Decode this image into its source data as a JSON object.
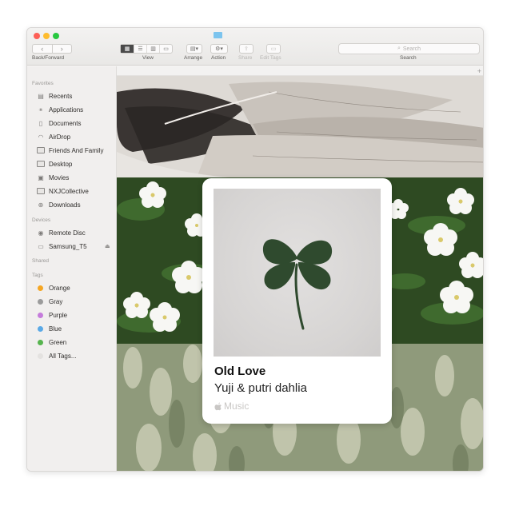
{
  "toolbar": {
    "nav_back_icon": "chevron-left",
    "nav_forward_icon": "chevron-right",
    "back_forward_label": "Back/Forward",
    "view_label": "View",
    "arrange_label": "Arrange",
    "action_label": "Action",
    "share_label": "Share",
    "edit_tags_label": "Edit Tags",
    "search_placeholder": "Search",
    "search_label": "Search"
  },
  "sidebar": {
    "favorites_header": "Favorites",
    "favorites": [
      {
        "label": "Recents",
        "icon": "recents-icon"
      },
      {
        "label": "Applications",
        "icon": "applications-icon"
      },
      {
        "label": "Documents",
        "icon": "documents-icon"
      },
      {
        "label": "AirDrop",
        "icon": "airdrop-icon"
      },
      {
        "label": "Friends And Family",
        "icon": "folder-icon"
      },
      {
        "label": "Desktop",
        "icon": "desktop-icon"
      },
      {
        "label": "Movies",
        "icon": "movies-icon"
      },
      {
        "label": "NXJCollective",
        "icon": "folder-icon"
      },
      {
        "label": "Downloads",
        "icon": "downloads-icon"
      }
    ],
    "devices_header": "Devices",
    "devices": [
      {
        "label": "Remote Disc",
        "icon": "disc-icon"
      },
      {
        "label": "Samsung_T5",
        "icon": "drive-icon"
      }
    ],
    "shared_header": "Shared",
    "tags_header": "Tags",
    "tags": [
      {
        "label": "Orange",
        "color": "#f5a623"
      },
      {
        "label": "Gray",
        "color": "#9b9b9b"
      },
      {
        "label": "Purple",
        "color": "#c57cdb"
      },
      {
        "label": "Blue",
        "color": "#5aa9e6"
      },
      {
        "label": "Green",
        "color": "#56b44e"
      },
      {
        "label": "All Tags...",
        "color": "#e4e2e0"
      }
    ]
  },
  "card": {
    "title": "Old Love",
    "artist": "Yuji & putri dahlia",
    "service": "Music"
  },
  "colors": {
    "window_bg": "#f6f5f4",
    "sidebar_bg": "#f1efee",
    "accent_close": "#fd5f57",
    "accent_min": "#febc2e",
    "accent_max": "#28c840"
  }
}
